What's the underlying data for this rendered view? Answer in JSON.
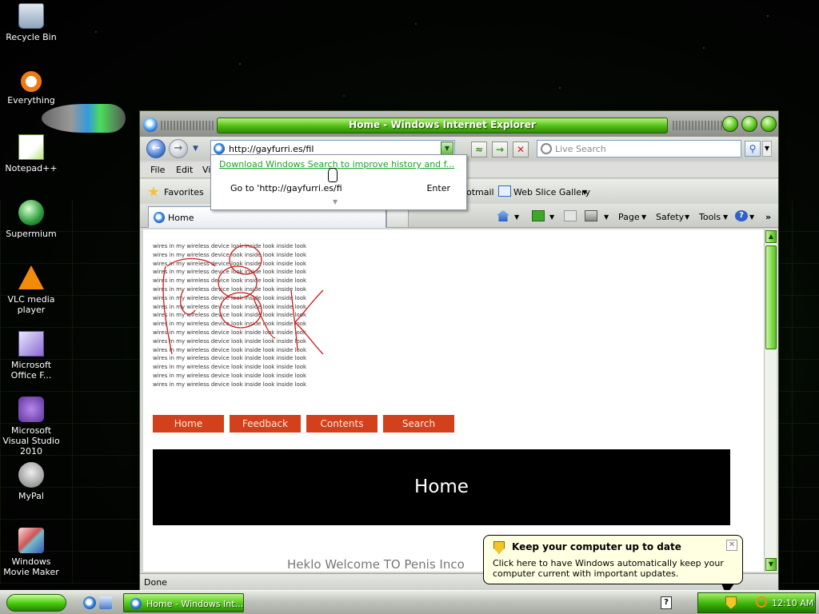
{
  "desktop": {
    "icons": [
      {
        "label": "Recycle Bin",
        "icon": "recycle-bin-icon"
      },
      {
        "label": "Everything",
        "icon": "everything-search-icon"
      },
      {
        "label": "Notepad++",
        "icon": "notepad-plus-plus-icon"
      },
      {
        "label": "Supermium",
        "icon": "supermium-browser-icon"
      },
      {
        "label": "VLC media player",
        "icon": "vlc-cone-icon"
      },
      {
        "label": "Microsoft Office F...",
        "icon": "office-document-icon"
      },
      {
        "label": "Microsoft Visual Studio 2010",
        "icon": "visual-studio-icon"
      },
      {
        "label": "MyPal",
        "icon": "mypal-browser-icon"
      },
      {
        "label": "Windows Movie Maker",
        "icon": "movie-maker-icon"
      }
    ]
  },
  "window": {
    "title": "Home - Windows Internet Explorer",
    "address": "http://gayfurri.es/fil",
    "search_placeholder": "Live Search",
    "menu": [
      "File",
      "Edit",
      "Vi"
    ],
    "favorites_label": "Favorites",
    "fav_links": [
      "otmail",
      "Web Slice Gallery"
    ],
    "tab_label": "Home",
    "commands": {
      "page": "Page",
      "safety": "Safety",
      "tools": "Tools"
    },
    "status": "Done"
  },
  "autocomplete": {
    "link": "Download Windows Search to improve history and f...",
    "goto": "Go to 'http://gayfurri.es/fi",
    "enter": "Enter"
  },
  "page": {
    "banner_text": "wires in my wireless device look inside look inside look",
    "banner_line_count": 17,
    "nav": [
      "Home",
      "Feedback",
      "Contents",
      "Search"
    ],
    "hero_title": "Home",
    "welcome": "Heklo Welcome TO Penis Inco"
  },
  "taskbar": {
    "task_label": "Home - Windows Int...",
    "clock": "12:10 AM"
  },
  "balloon": {
    "title": "Keep your computer up to date",
    "body": "Click here to have Windows automatically keep your computer current with important updates."
  },
  "colors": {
    "accent_green": "#4fbf14",
    "nav_button": "#d2401c",
    "link_green": "#1aa32a"
  }
}
